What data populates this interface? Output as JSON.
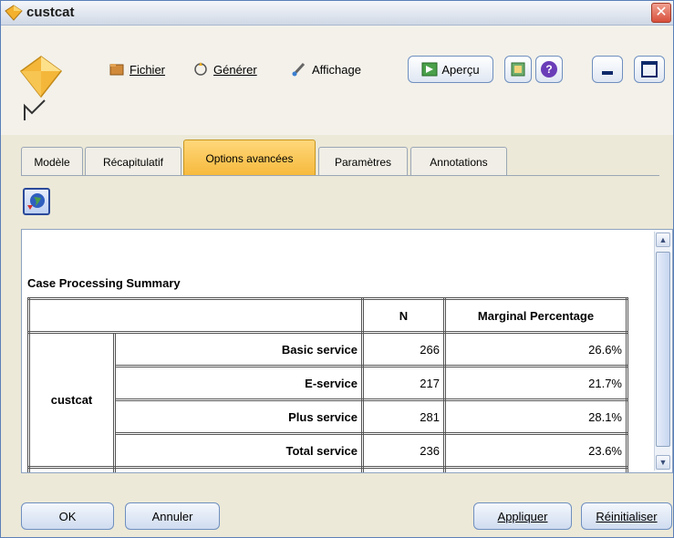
{
  "window": {
    "title": "custcat",
    "close_glyph": "✕"
  },
  "toolbar": {
    "file_label": "Fichier",
    "generate_label": "Générer",
    "view_label": "Affichage",
    "preview_label": "Aperçu",
    "help_glyph": "?"
  },
  "tabs": [
    {
      "label": "Modèle"
    },
    {
      "label": "Récapitulatif"
    },
    {
      "label": "Options avancées",
      "active": true
    },
    {
      "label": "Paramètres"
    },
    {
      "label": "Annotations"
    }
  ],
  "output": {
    "table_title": "Case Processing Summary",
    "headers": {
      "n": "N",
      "marginal": "Marginal Percentage"
    },
    "group_label": "custcat",
    "rows": [
      {
        "label": "Basic service",
        "n": "266",
        "pct": "26.6%"
      },
      {
        "label": "E-service",
        "n": "217",
        "pct": "21.7%"
      },
      {
        "label": "Plus service",
        "n": "281",
        "pct": "28.1%"
      },
      {
        "label": "Total service",
        "n": "236",
        "pct": "23.6%"
      }
    ]
  },
  "buttons": {
    "ok": "OK",
    "cancel": "Annuler",
    "apply": "Appliquer",
    "reset": "Réinitialiser"
  },
  "icons": {
    "title": "model-nugget-icon",
    "file": "folder-icon",
    "generate": "generate-icon",
    "view": "brush-icon",
    "preview": "preview-icon",
    "export": "export-icon",
    "help": "help-icon",
    "minimize": "minimize-icon",
    "maximize": "maximize-icon",
    "tool": "globe-icon"
  },
  "colors": {
    "active_tab": "#f6b93b",
    "close": "#d8503c",
    "accent": "#6f8fbf"
  }
}
